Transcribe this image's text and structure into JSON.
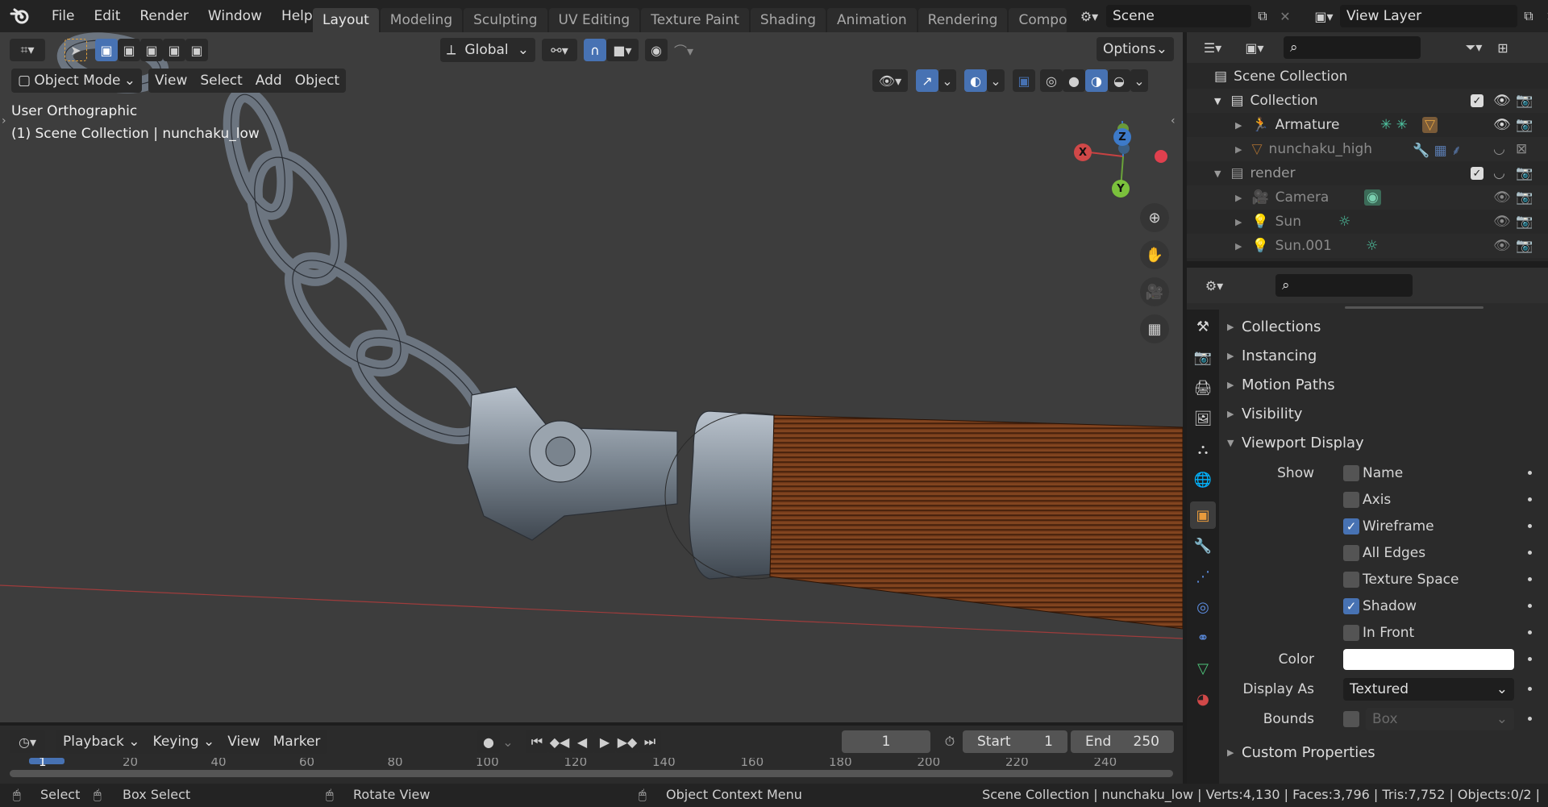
{
  "menu": [
    "File",
    "Edit",
    "Render",
    "Window",
    "Help"
  ],
  "workspaces": [
    "Layout",
    "Modeling",
    "Sculpting",
    "UV Editing",
    "Texture Paint",
    "Shading",
    "Animation",
    "Rendering",
    "Compos"
  ],
  "active_workspace": "Layout",
  "scene": "Scene",
  "view_layer": "View Layer",
  "viewport": {
    "transform_orientation": "Global",
    "options_label": "Options",
    "mode": "Object Mode",
    "menus": [
      "View",
      "Select",
      "Add",
      "Object"
    ],
    "view_name": "User Orthographic",
    "info": "(1) Scene Collection | nunchaku_low",
    "gizmo": {
      "x": "X",
      "y": "Y",
      "z": "Z"
    }
  },
  "outliner": {
    "root": "Scene Collection",
    "rows": [
      {
        "label": "Collection",
        "indent": 1
      },
      {
        "label": "Armature",
        "indent": 2
      },
      {
        "label": "nunchaku_high",
        "indent": 2
      },
      {
        "label": "render",
        "indent": 1
      },
      {
        "label": "Camera",
        "indent": 2
      },
      {
        "label": "Sun",
        "indent": 2
      },
      {
        "label": "Sun.001",
        "indent": 2
      }
    ]
  },
  "properties": {
    "panels_top": [
      "Collections",
      "Instancing",
      "Motion Paths",
      "Visibility"
    ],
    "viewport_display": "Viewport Display",
    "show_label": "Show",
    "show_options": [
      {
        "label": "Name",
        "checked": false
      },
      {
        "label": "Axis",
        "checked": false
      },
      {
        "label": "Wireframe",
        "checked": true
      },
      {
        "label": "All Edges",
        "checked": false
      },
      {
        "label": "Texture Space",
        "checked": false
      },
      {
        "label": "Shadow",
        "checked": true
      },
      {
        "label": "In Front",
        "checked": false
      }
    ],
    "color_label": "Color",
    "color_value": "#ffffff",
    "display_as_label": "Display As",
    "display_as_value": "Textured",
    "bounds_label": "Bounds",
    "bounds_value": "Box",
    "custom_properties": "Custom Properties"
  },
  "timeline": {
    "menus": [
      "Playback",
      "Keying",
      "View",
      "Marker"
    ],
    "current_frame": "1",
    "start_label": "Start",
    "start": "1",
    "end_label": "End",
    "end": "250",
    "ruler": [
      "1",
      "20",
      "40",
      "60",
      "80",
      "100",
      "120",
      "140",
      "160",
      "180",
      "200",
      "220",
      "240"
    ]
  },
  "statusbar": {
    "select": "Select",
    "box_select": "Box Select",
    "rotate_view": "Rotate View",
    "context_menu": "Object Context Menu",
    "stats": "Scene Collection | nunchaku_low | Verts:4,130 | Faces:3,796 | Tris:7,752 | Objects:0/2 |"
  }
}
